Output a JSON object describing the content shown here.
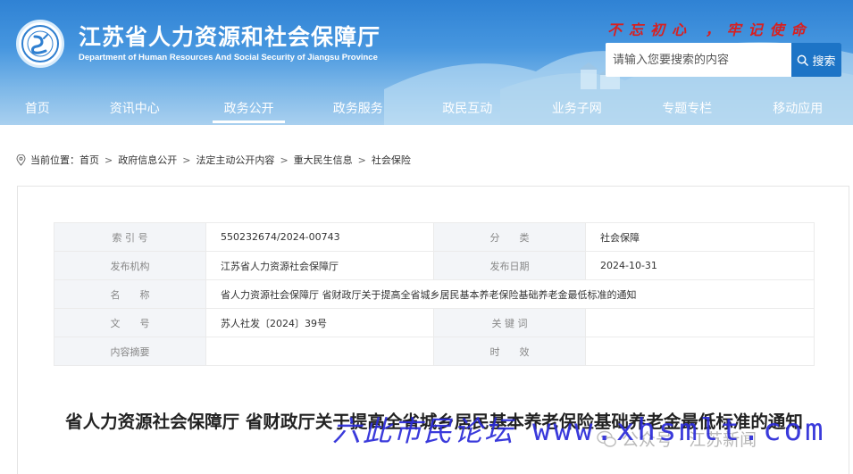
{
  "header": {
    "title": "江苏省人力资源和社会保障厅",
    "subtitle": "Department of Human Resources And Social Security of Jiangsu Province",
    "slogan": "不忘初心 ，牢记使命",
    "search": {
      "placeholder": "请输入您要搜索的内容",
      "button_label": "搜索"
    }
  },
  "nav": {
    "items": [
      {
        "label": "首页"
      },
      {
        "label": "资讯中心"
      },
      {
        "label": "政务公开",
        "active": true
      },
      {
        "label": "政务服务"
      },
      {
        "label": "政民互动"
      },
      {
        "label": "业务子网"
      },
      {
        "label": "专题专栏"
      },
      {
        "label": "移动应用"
      }
    ]
  },
  "breadcrumb": {
    "prefix": "当前位置：",
    "items": [
      "首页",
      "政府信息公开",
      "法定主动公开内容",
      "重大民生信息",
      "社会保险"
    ],
    "separator": ">"
  },
  "meta": {
    "index_label": "索 引 号",
    "index_value": "550232674/2024-00743",
    "category_label": "分　　类",
    "category_value": "社会保障",
    "publisher_label": "发布机构",
    "publisher_value": "江苏省人力资源社会保障厅",
    "date_label": "发布日期",
    "date_value": "2024-10-31",
    "name_label": "名　　称",
    "name_value": "省人力资源社会保障厅 省财政厅关于提高全省城乡居民基本养老保险基础养老金最低标准的通知",
    "doc_no_label": "文　　号",
    "doc_no_value": "苏人社发〔2024〕39号",
    "keywords_label": "关 键 词",
    "keywords_value": "",
    "summary_label": "内容摘要",
    "summary_value": "",
    "validity_label": "时　　效",
    "validity_value": ""
  },
  "article": {
    "title": "省人力资源社会保障厅 省财政厅关于提高全省城乡居民基本养老保险基础养老金最低标准的通知"
  },
  "watermark": {
    "left_text": "六此市民论坛",
    "url_text": "www.xhsmlt.com",
    "source_text": "公众号 · 江苏新闻"
  }
}
